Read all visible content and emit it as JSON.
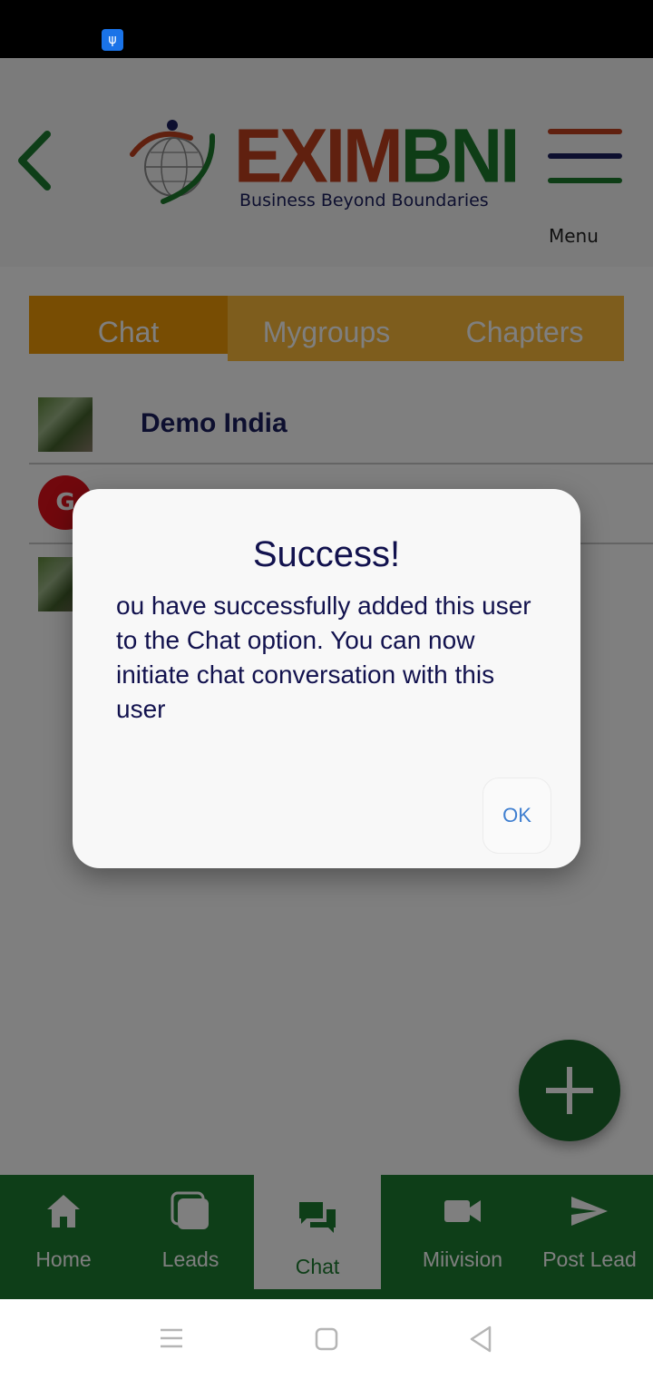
{
  "header": {
    "logo_name_part1": "EXIM",
    "logo_name_part2": "BNI",
    "logo_tagline": "Business Beyond Boundaries",
    "menu_label": "Menu"
  },
  "tabs": [
    {
      "label": "Chat",
      "active": true
    },
    {
      "label": "Mygroups",
      "active": false
    },
    {
      "label": "Chapters",
      "active": false
    }
  ],
  "chat_list": [
    {
      "name": "Demo India",
      "avatar_letter": ""
    },
    {
      "name": "",
      "avatar_letter": "G"
    },
    {
      "name": "",
      "avatar_letter": ""
    }
  ],
  "bottom_nav": [
    {
      "label": "Home",
      "icon": "home-icon"
    },
    {
      "label": "Leads",
      "icon": "leads-icon"
    },
    {
      "label": "Chat",
      "icon": "chat-icon",
      "active": true
    },
    {
      "label": "Miivision",
      "icon": "video-icon"
    },
    {
      "label": "Post Lead",
      "icon": "send-icon"
    }
  ],
  "dialog": {
    "title": "Success!",
    "message": "ou have successfully added this user to the Chat option. You can now initiate chat conversation with this user",
    "ok_label": "OK"
  },
  "colors": {
    "brand_green": "#1d7d30",
    "brand_orange": "#f09a06",
    "brand_red": "#c0401f",
    "navy": "#1b1f5e"
  }
}
